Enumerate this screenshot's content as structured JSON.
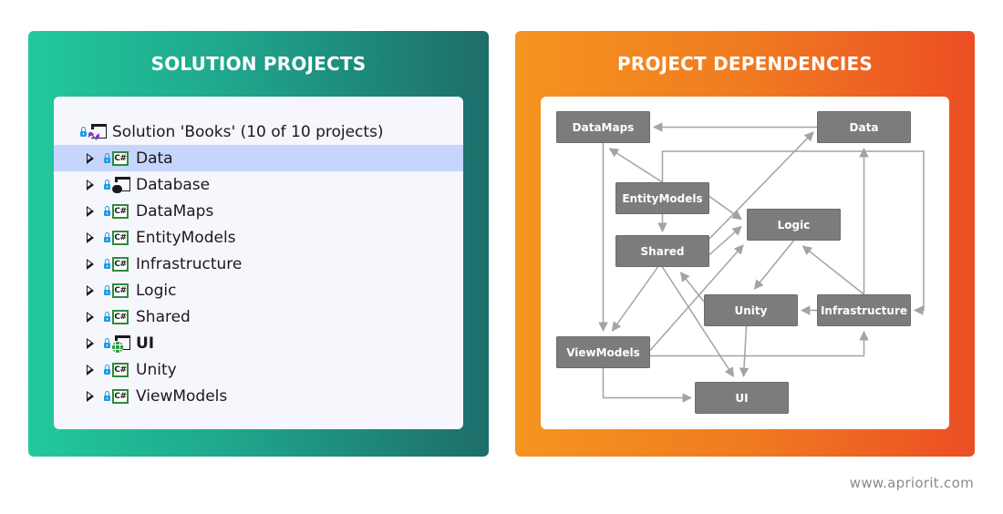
{
  "left_panel": {
    "title": "SOLUTION PROJECTS",
    "gradient": [
      "#22c99c",
      "#1d6d6b"
    ],
    "solution": {
      "label": "Solution 'Books' (10 of 10 projects)",
      "icon": "visual-studio-solution-icon"
    },
    "projects": [
      {
        "name": "Data",
        "icon": "csharp-project-icon",
        "selected": true,
        "bold": false
      },
      {
        "name": "Database",
        "icon": "database-project-icon",
        "selected": false,
        "bold": false
      },
      {
        "name": "DataMaps",
        "icon": "csharp-project-icon",
        "selected": false,
        "bold": false
      },
      {
        "name": "EntityModels",
        "icon": "csharp-project-icon",
        "selected": false,
        "bold": false
      },
      {
        "name": "Infrastructure",
        "icon": "csharp-project-icon",
        "selected": false,
        "bold": false
      },
      {
        "name": "Logic",
        "icon": "csharp-project-icon",
        "selected": false,
        "bold": false
      },
      {
        "name": "Shared",
        "icon": "csharp-project-icon",
        "selected": false,
        "bold": false
      },
      {
        "name": "UI",
        "icon": "web-project-icon",
        "selected": false,
        "bold": true
      },
      {
        "name": "Unity",
        "icon": "csharp-project-icon",
        "selected": false,
        "bold": false
      },
      {
        "name": "ViewModels",
        "icon": "csharp-project-icon",
        "selected": false,
        "bold": false
      }
    ],
    "csharp_glyph": "C#"
  },
  "right_panel": {
    "title": "PROJECT DEPENDENCIES",
    "gradient": [
      "#f59420",
      "#ec4e24"
    ],
    "nodes": [
      {
        "id": "DataMaps",
        "label": "DataMaps"
      },
      {
        "id": "Data",
        "label": "Data"
      },
      {
        "id": "EntityModels",
        "label": "EntityModels"
      },
      {
        "id": "Logic",
        "label": "Logic"
      },
      {
        "id": "Shared",
        "label": "Shared"
      },
      {
        "id": "Unity",
        "label": "Unity"
      },
      {
        "id": "Infrastructure",
        "label": "Infrastructure"
      },
      {
        "id": "ViewModels",
        "label": "ViewModels"
      },
      {
        "id": "UI",
        "label": "UI"
      }
    ],
    "edges": [
      {
        "from": "Data",
        "to": "DataMaps"
      },
      {
        "from": "EntityModels",
        "to": "DataMaps"
      },
      {
        "from": "EntityModels",
        "to": "Infrastructure"
      },
      {
        "from": "EntityModels",
        "to": "Shared"
      },
      {
        "from": "EntityModels",
        "to": "Logic"
      },
      {
        "from": "Shared",
        "to": "Data"
      },
      {
        "from": "Shared",
        "to": "Logic"
      },
      {
        "from": "Shared",
        "to": "ViewModels"
      },
      {
        "from": "Shared",
        "to": "UI"
      },
      {
        "from": "DataMaps",
        "to": "ViewModels"
      },
      {
        "from": "ViewModels",
        "to": "Logic"
      },
      {
        "from": "ViewModels",
        "to": "Infrastructure"
      },
      {
        "from": "ViewModels",
        "to": "UI"
      },
      {
        "from": "Logic",
        "to": "Unity"
      },
      {
        "from": "Infrastructure",
        "to": "Logic"
      },
      {
        "from": "Infrastructure",
        "to": "Data"
      },
      {
        "from": "Infrastructure",
        "to": "Unity"
      },
      {
        "from": "Unity",
        "to": "Shared"
      },
      {
        "from": "Unity",
        "to": "UI"
      }
    ]
  },
  "footer": {
    "website": "www.apriorit.com"
  }
}
